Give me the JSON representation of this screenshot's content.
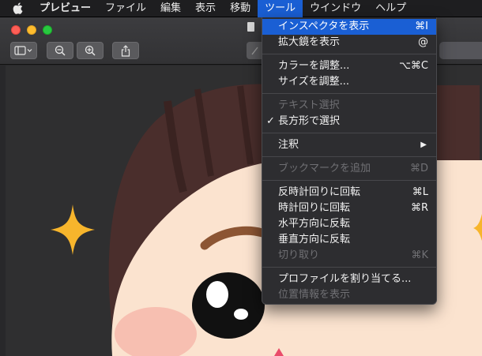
{
  "menubar": {
    "apple_icon": "apple-icon",
    "items": [
      "プレビュー",
      "ファイル",
      "編集",
      "表示",
      "移動",
      "ツール",
      "ウインドウ",
      "ヘルプ"
    ],
    "active_index": 5
  },
  "toolbar": {
    "icons": [
      "sidebar-toggle-icon",
      "zoom-out-icon",
      "zoom-in-icon",
      "share-icon"
    ]
  },
  "menu": {
    "items": [
      {
        "label": "インスペクタを表示",
        "shortcut": "⌘I",
        "highlighted": true
      },
      {
        "label": "拡大鏡を表示",
        "shortcut": "@"
      },
      {
        "separator": true
      },
      {
        "label": "カラーを調整...",
        "shortcut": "⌥⌘C"
      },
      {
        "label": "サイズを調整..."
      },
      {
        "separator": true
      },
      {
        "label": "テキスト選択",
        "disabled": true
      },
      {
        "label": "長方形で選択",
        "checked": true,
        "check": "✓"
      },
      {
        "separator": true
      },
      {
        "label": "注釈",
        "submenu": true,
        "arrow": "▶"
      },
      {
        "separator": true
      },
      {
        "label": "ブックマークを追加",
        "shortcut": "⌘D",
        "disabled": true
      },
      {
        "separator": true
      },
      {
        "label": "反時計回りに回転",
        "shortcut": "⌘L"
      },
      {
        "label": "時計回りに回転",
        "shortcut": "⌘R"
      },
      {
        "label": "水平方向に反転"
      },
      {
        "label": "垂直方向に反転"
      },
      {
        "label": "切り取り",
        "shortcut": "⌘K",
        "disabled": true
      },
      {
        "separator": true
      },
      {
        "label": "プロファイルを割り当てる..."
      },
      {
        "label": "位置情報を表示",
        "disabled": true
      }
    ]
  },
  "colors": {
    "menu_highlight": "#1a5fd4",
    "star": "#f7b52c",
    "hair": "#4a2e2c",
    "skin": "#fbe3cf",
    "brow": "#8c5533"
  }
}
